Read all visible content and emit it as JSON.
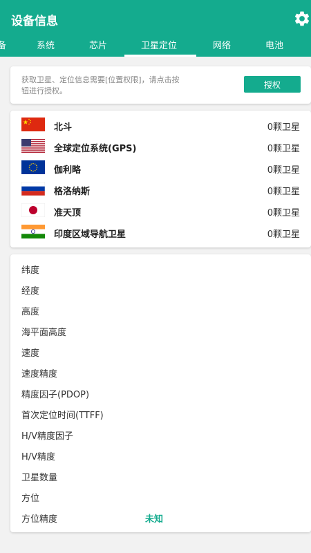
{
  "header": {
    "title": "设备信息",
    "settings_icon": "gear-icon",
    "bg_color": "#14ab8e"
  },
  "tabs": [
    {
      "label": "备"
    },
    {
      "label": "系统"
    },
    {
      "label": "芯片"
    },
    {
      "label": "卫星定位",
      "selected": true
    },
    {
      "label": "网络"
    },
    {
      "label": "电池"
    }
  ],
  "permission": {
    "message": "获取卫星、定位信息需要[位置权限]，请点击按钮进行授权。",
    "button_label": "授权"
  },
  "satellites": [
    {
      "name": "北斗",
      "count": "0颗卫星",
      "flag": "china-flag-icon"
    },
    {
      "name": "全球定位系统(GPS)",
      "count": "0颗卫星",
      "flag": "usa-flag-icon"
    },
    {
      "name": "伽利略",
      "count": "0颗卫星",
      "flag": "eu-flag-icon"
    },
    {
      "name": "格洛纳斯",
      "count": "0颗卫星",
      "flag": "russia-flag-icon"
    },
    {
      "name": "准天顶",
      "count": "0颗卫星",
      "flag": "japan-flag-icon"
    },
    {
      "name": "印度区域导航卫星",
      "count": "0颗卫星",
      "flag": "india-flag-icon"
    }
  ],
  "location": [
    {
      "label": "纬度",
      "value": ""
    },
    {
      "label": "经度",
      "value": ""
    },
    {
      "label": "高度",
      "value": ""
    },
    {
      "label": "海平面高度",
      "value": ""
    },
    {
      "label": "速度",
      "value": ""
    },
    {
      "label": "速度精度",
      "value": ""
    },
    {
      "label": "精度因子(PDOP)",
      "value": ""
    },
    {
      "label": "首次定位时间(TTFF)",
      "value": ""
    },
    {
      "label": "H/V精度因子",
      "value": ""
    },
    {
      "label": "H/V精度",
      "value": ""
    },
    {
      "label": "卫星数量",
      "value": ""
    },
    {
      "label": "方位",
      "value": ""
    },
    {
      "label": "方位精度",
      "value": "未知"
    }
  ]
}
